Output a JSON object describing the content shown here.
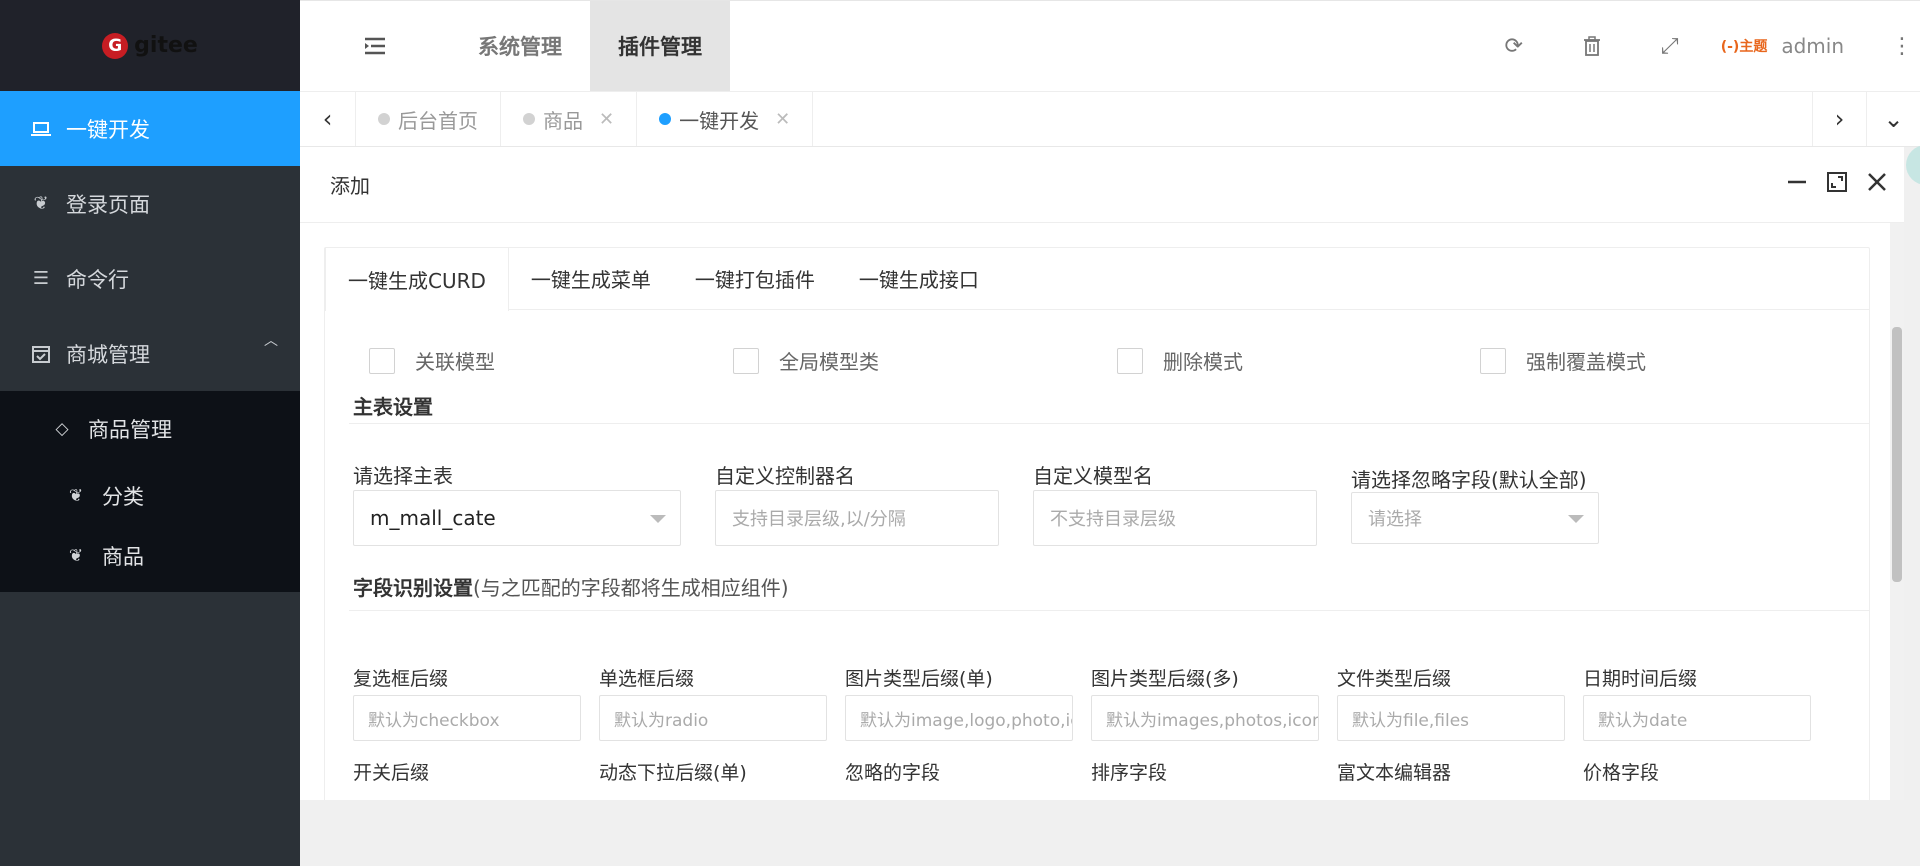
{
  "logo": {
    "text": "gitee",
    "mark": "G"
  },
  "sidebar": {
    "items": [
      {
        "label": "一键开发",
        "icon": "laptop-icon",
        "active": true
      },
      {
        "label": "登录页面",
        "icon": "sprout-icon"
      },
      {
        "label": "命令行",
        "icon": "list-icon"
      },
      {
        "label": "商城管理",
        "icon": "calendar-check-icon"
      }
    ],
    "submenu": {
      "label": "商品管理",
      "icon": "diamond-icon",
      "children": [
        {
          "label": "分类",
          "icon": "sprout-icon"
        },
        {
          "label": "商品",
          "icon": "sprout-icon"
        }
      ]
    }
  },
  "header": {
    "tabs": [
      {
        "label": "系统管理"
      },
      {
        "label": "插件管理",
        "active": true
      }
    ],
    "brand_mini": "(-)主题",
    "user": "admin"
  },
  "tabbar": {
    "tabs": [
      {
        "label": "后台首页"
      },
      {
        "label": "商品"
      },
      {
        "label": "一键开发",
        "active": true
      }
    ]
  },
  "dialog": {
    "title": "添加",
    "tabs": [
      "一键生成CURD",
      "一键生成菜单",
      "一键打包插件",
      "一键生成接口"
    ],
    "checkboxes": [
      "关联模型",
      "全局模型类",
      "删除模式",
      "强制覆盖模式"
    ],
    "main_section": "主表设置",
    "main_fields": {
      "table_label": "请选择主表",
      "table_value": "m_mall_cate",
      "controller_label": "自定义控制器名",
      "controller_placeholder": "支持目录层级,以/分隔",
      "model_label": "自定义模型名",
      "model_placeholder": "不支持目录层级",
      "ignore_label": "请选择忽略字段(默认全部)",
      "ignore_placeholder": "请选择"
    },
    "field_section": "字段识别设置",
    "field_section_note": "(与之匹配的字段都将生成相应组件)",
    "suffix_fields": [
      {
        "label": "复选框后缀",
        "placeholder": "默认为checkbox"
      },
      {
        "label": "单选框后缀",
        "placeholder": "默认为radio"
      },
      {
        "label": "图片类型后缀(单)",
        "placeholder": "默认为image,logo,photo,ic"
      },
      {
        "label": "图片类型后缀(多)",
        "placeholder": "默认为images,photos,icon"
      },
      {
        "label": "文件类型后缀",
        "placeholder": "默认为file,files"
      },
      {
        "label": "日期时间后缀",
        "placeholder": "默认为date"
      }
    ],
    "second_row_labels": [
      "开关后缀",
      "动态下拉后缀(单)",
      "忽略的字段",
      "排序字段",
      "富文本编辑器",
      "价格字段"
    ]
  }
}
